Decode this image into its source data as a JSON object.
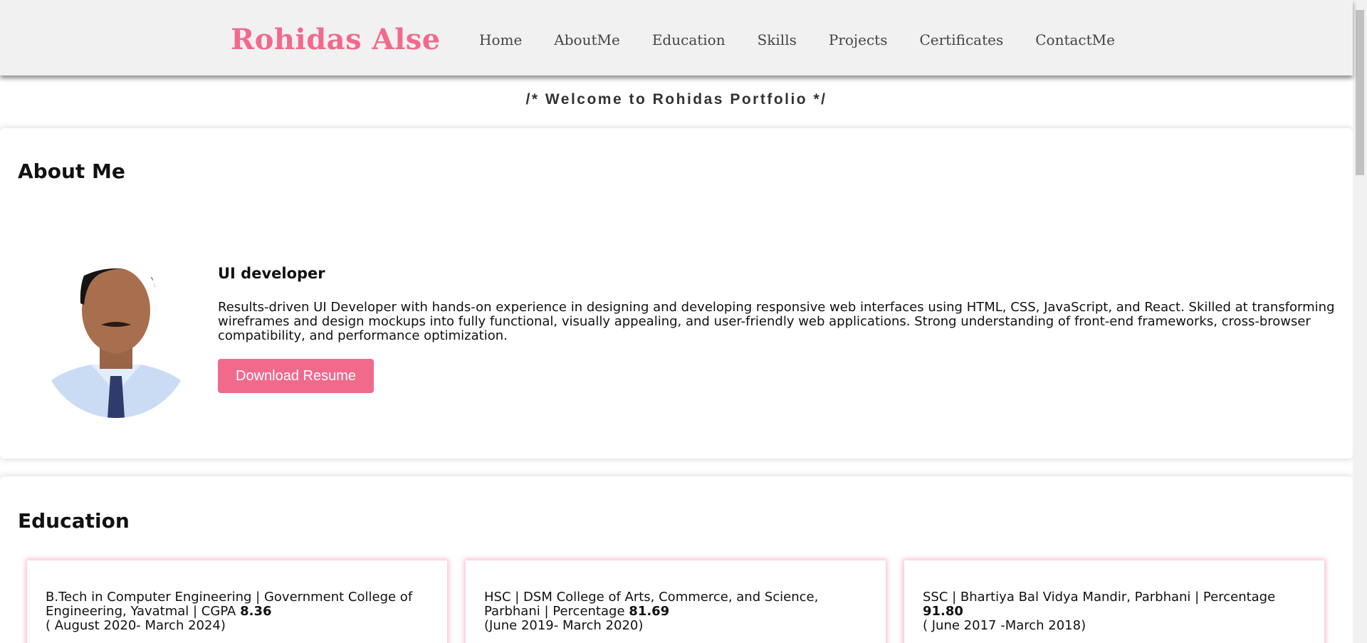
{
  "header": {
    "brand": "Rohidas Alse",
    "nav": [
      "Home",
      "AboutMe",
      "Education",
      "Skills",
      "Projects",
      "Certificates",
      "ContactMe"
    ]
  },
  "welcome": "/* Welcome to Rohidas Portfolio */",
  "about": {
    "title": "About Me",
    "role": "UI developer",
    "summary": "Results-driven UI Developer with hands-on experience in designing and developing responsive web interfaces using HTML, CSS, JavaScript, and React. Skilled at transforming wireframes and design mockups into fully functional, visually appealing, and user-friendly web applications. Strong understanding of front-end frameworks, cross-browser compatibility, and performance optimization.",
    "resume_button": "Download Resume"
  },
  "education": {
    "title": "Education",
    "items": [
      {
        "text": "B.Tech in Computer Engineering | Government College of Engineering, Yavatmal | CGPA",
        "score": "8.36",
        "period": "( August 2020- March 2024)"
      },
      {
        "text": "HSC | DSM College of Arts, Commerce, and Science, Parbhani | Percentage",
        "score": "81.69",
        "period": "(June 2019- March 2020)"
      },
      {
        "text": "SSC | Bhartiya Bal Vidya Mandir, Parbhani | Percentage",
        "score": "91.80",
        "period": "( June 2017 -March 2018)"
      }
    ]
  },
  "colors": {
    "accent": "#f16a8c",
    "navbar_bg": "#f1f1f1"
  }
}
